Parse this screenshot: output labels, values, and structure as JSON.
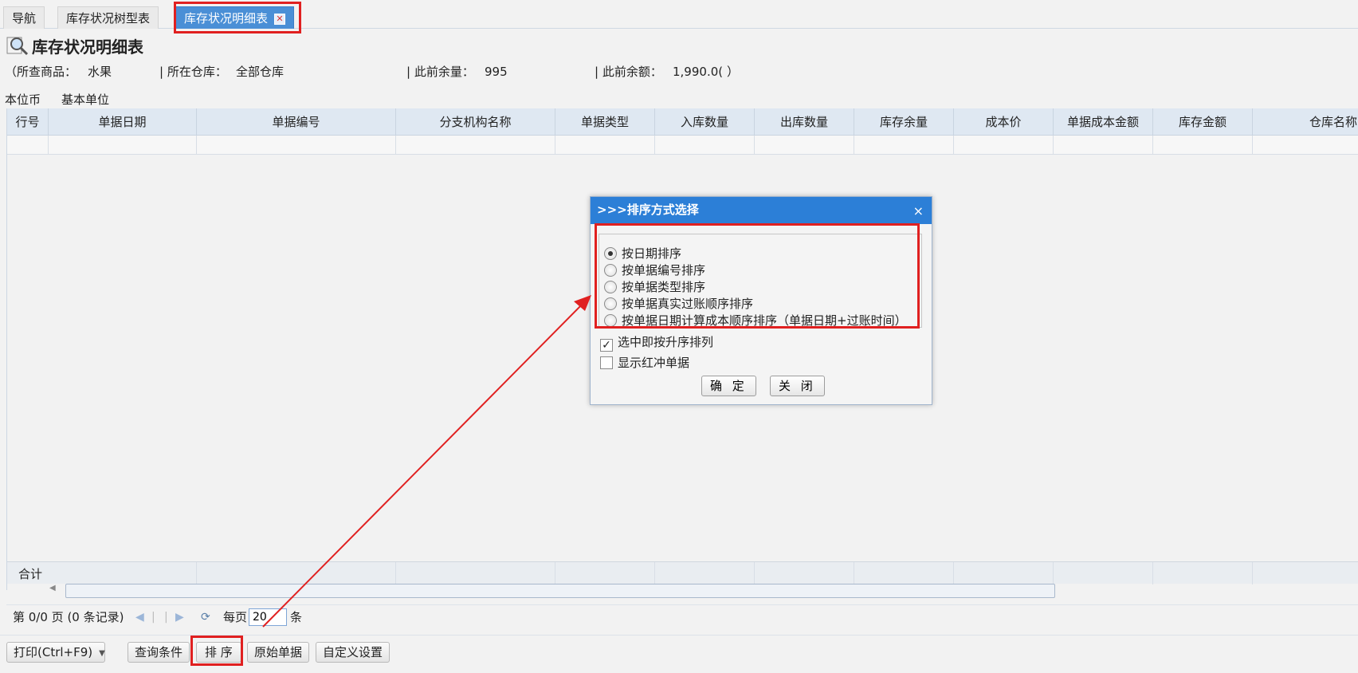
{
  "tabs": [
    {
      "label": "导航"
    },
    {
      "label": "库存状况树型表"
    },
    {
      "label": "库存状况明细表",
      "close": "✕"
    }
  ],
  "title": "库存状况明细表",
  "info": {
    "product_label": "（所查商品：",
    "product_value": "水果",
    "warehouse_label": "| 所在仓库：",
    "warehouse_value": "全部仓库",
    "prev_qty_label": "| 此前余量：",
    "prev_qty_value": "995",
    "prev_amount_label": "| 此前余额：",
    "prev_amount_value": "1,990.0(",
    "close_paren": "）"
  },
  "units": {
    "currency": "本位币",
    "unit": "基本单位"
  },
  "grid": {
    "columns": [
      "行号",
      "单据日期",
      "单据编号",
      "分支机构名称",
      "单据类型",
      "入库数量",
      "出库数量",
      "库存余量",
      "成本价",
      "单据成本金额",
      "库存金额",
      "仓库名称"
    ],
    "sum_label": "合计"
  },
  "pager": {
    "page_text": "第 0/0 页 (0 条记录)",
    "per_page_label": "每页",
    "per_page_value": "20",
    "unit": "条"
  },
  "toolbar": {
    "print": "打印(Ctrl+F9)",
    "query": "查询条件",
    "sort": "排 序",
    "original": "原始单据",
    "custom": "自定义设置"
  },
  "dialog": {
    "title": ">>>排序方式选择",
    "close": "×",
    "options": [
      "按日期排序",
      "按单据编号排序",
      "按单据类型排序",
      "按单据真实过账顺序排序",
      "按单据日期计算成本顺序排序（单据日期+过账时间）"
    ],
    "selected_index": 0,
    "asc_label": "选中即按升序排列",
    "asc_checked": true,
    "red_label": "显示红冲单据",
    "red_checked": false,
    "ok": "确 定",
    "cancel": "关 闭"
  },
  "colors": {
    "accent": "#2c7fd7",
    "highlight": "#e02020"
  }
}
